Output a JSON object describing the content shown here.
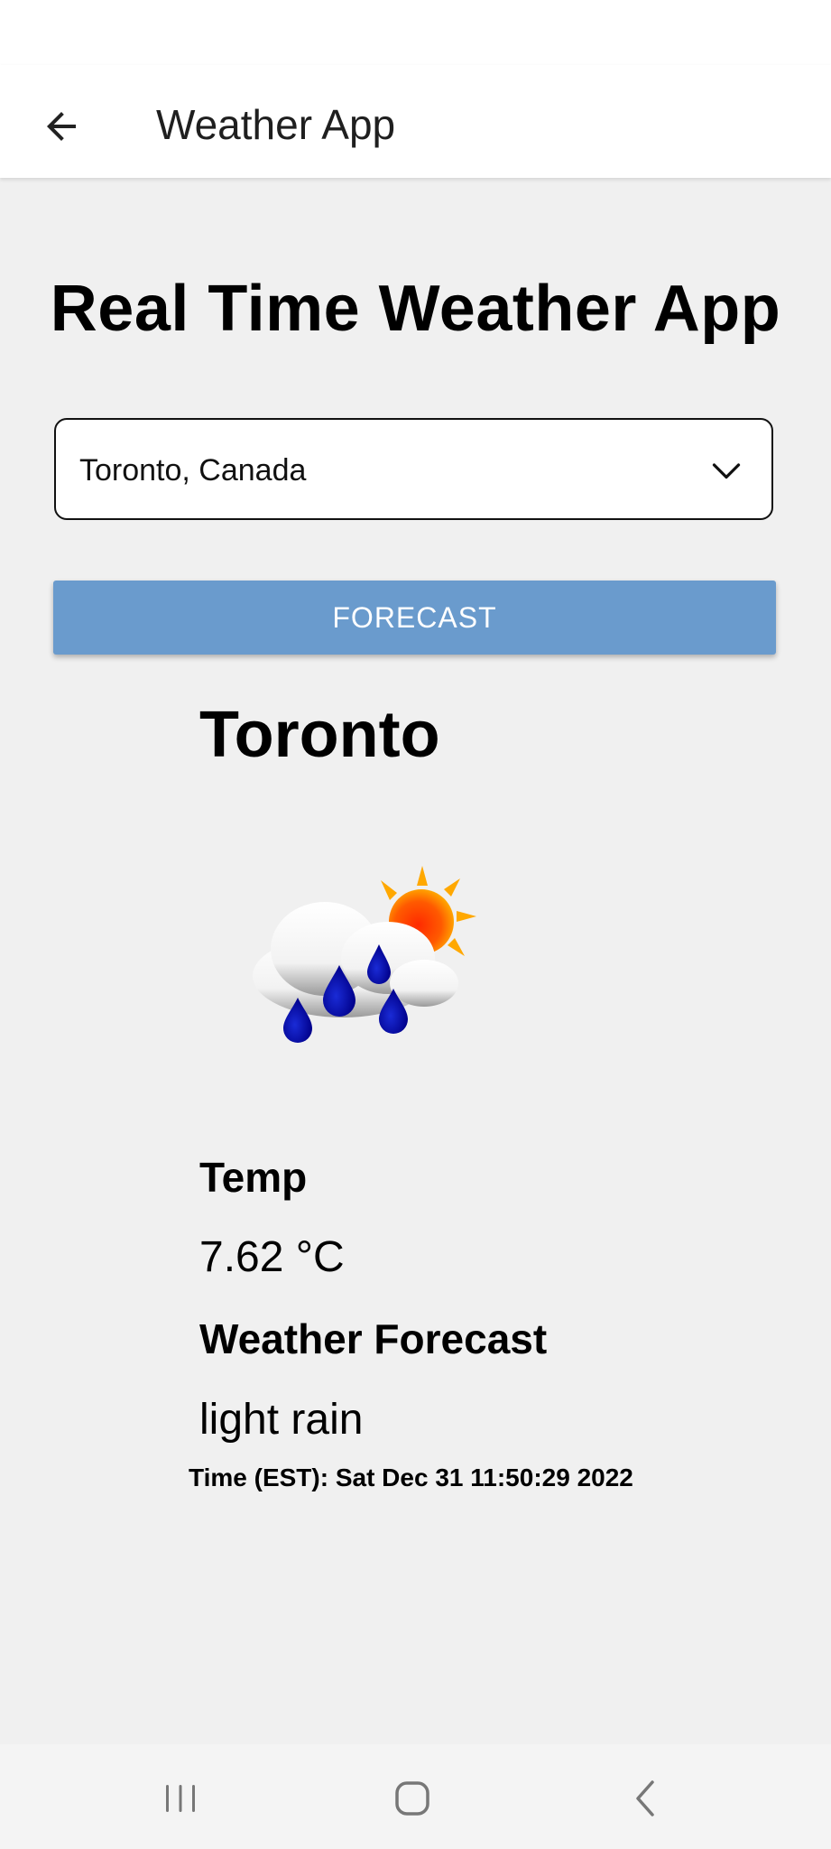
{
  "header": {
    "title": "Weather App",
    "back_icon": "arrow-left-icon"
  },
  "main": {
    "heading": "Real Time Weather App",
    "city_select": {
      "value": "Toronto, Canada",
      "icon": "chevron-down-icon"
    },
    "forecast_button_label": "FORECAST",
    "accent_color": "#6a9bcd"
  },
  "weather": {
    "city": "Toronto",
    "icon": "rain-cloud-sun-icon",
    "temp_label": "Temp",
    "temp_value": "7.62 °C",
    "forecast_label": "Weather Forecast",
    "forecast_value": "light rain",
    "time_text": "Time (EST): Sat Dec 31 11:50:29 2022"
  },
  "navbar": {
    "recents_icon": "recents-icon",
    "home_icon": "home-icon",
    "back_icon": "back-chevron-icon"
  }
}
